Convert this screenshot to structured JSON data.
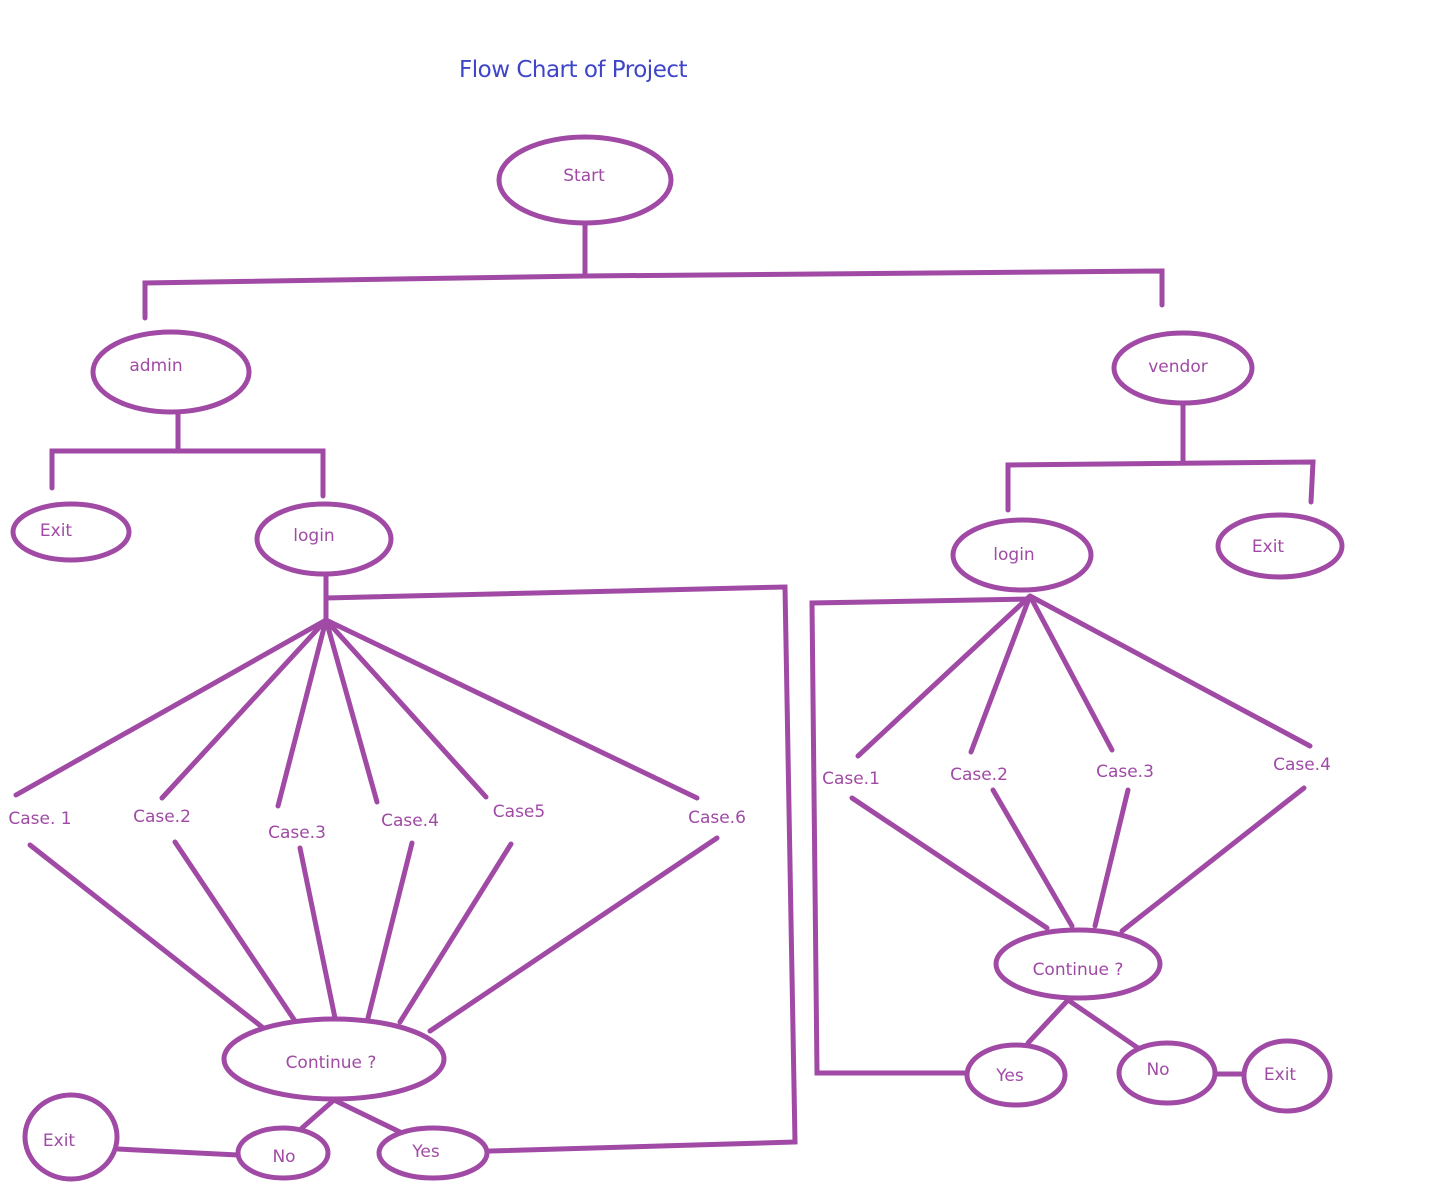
{
  "title": "Flow Chart of Project",
  "colors": {
    "title": "#3e45c8",
    "stroke": "#a04aa5",
    "text": "#a04aa5"
  },
  "nodes": {
    "start": "Start",
    "admin": "admin",
    "vendor": "vendor",
    "admin_exit": "Exit",
    "admin_login": "login",
    "vendor_login": "login",
    "vendor_exit": "Exit",
    "admin_cases": [
      "Case. 1",
      "Case.2",
      "Case.3",
      "Case.4",
      "Case5",
      "Case.6"
    ],
    "vendor_cases": [
      "Case.1",
      "Case.2",
      "Case.3",
      "Case.4"
    ],
    "admin_continue": "Continue ?",
    "admin_no": "No",
    "admin_yes": "Yes",
    "admin_final_exit": "Exit",
    "vendor_continue": "Continue  ?",
    "vendor_yes": "Yes",
    "vendor_no": "No",
    "vendor_final_exit": "Exit"
  }
}
